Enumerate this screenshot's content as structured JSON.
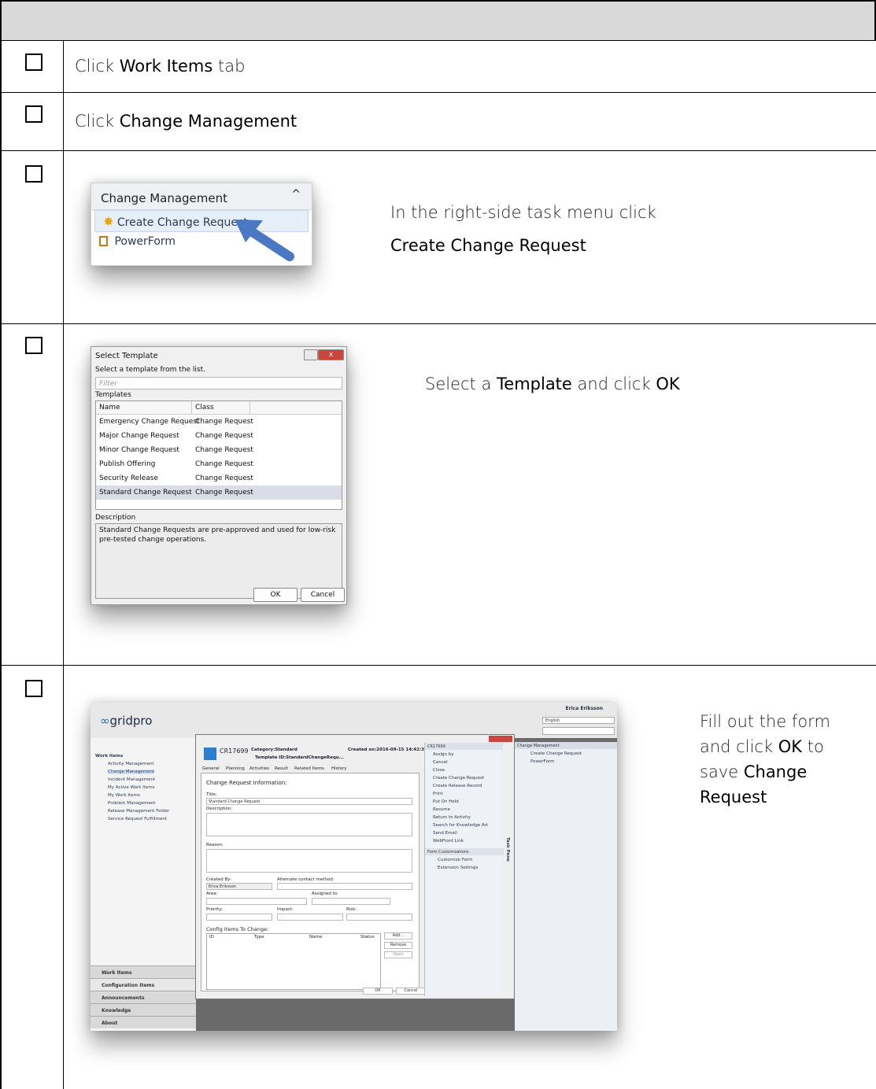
{
  "rows": [
    {
      "text_pre": "Click ",
      "bold": "Work Items",
      "text_post": " tab"
    },
    {
      "text_pre": "Click ",
      "bold": "Change Management",
      "text_post": ""
    }
  ],
  "step3": {
    "line1": "In the right-side task menu click",
    "bold": "Create Change Request",
    "shot": {
      "header": "Change Management",
      "items": [
        "Create Change Request",
        "PowerForm"
      ]
    }
  },
  "step4": {
    "pre": "Select a ",
    "bold1": "Template",
    "mid": " and click ",
    "bold2": "OK",
    "dialog": {
      "title": "Select Template",
      "instruction": "Select a template from the list.",
      "filter_placeholder": "Filter",
      "templates_label": "Templates",
      "columns": [
        "Name",
        "Class"
      ],
      "rows": [
        [
          "Emergency Change Request",
          "Change Request"
        ],
        [
          "Major Change Request",
          "Change Request"
        ],
        [
          "Minor Change Request",
          "Change Request"
        ],
        [
          "Publish Offering",
          "Change Request"
        ],
        [
          "Security Release",
          "Change Request"
        ],
        [
          "Standard Change Request",
          "Change Request"
        ]
      ],
      "description_label": "Description",
      "description": "Standard Change Requests are pre-approved and used for low-risk pre-tested change operations.",
      "ok": "OK",
      "cancel": "Cancel"
    }
  },
  "step5": {
    "l1": "Fill out the form",
    "l2pre": "and click ",
    "l2bold": "OK",
    "l2post": " to",
    "l3pre": "save ",
    "l3bold": "Change",
    "l4bold": "Request",
    "shot": {
      "logo": "gridpro",
      "user": "Erica Eriksson",
      "language": "English",
      "tree": [
        "Work Items",
        "Activity Management",
        "Change Management",
        "Incident Management",
        "My Active Work Items",
        "My Work Items",
        "Problem Management",
        "Release Management Folder",
        "Service Request Fulfillment"
      ],
      "nav": [
        "Work Items",
        "Configuration Items",
        "Announcements",
        "Knowledge",
        "About"
      ],
      "cr_id": "CR17699",
      "category": "Category:Standard",
      "template": "Template ID:StandardChangeRequ...",
      "created": "Created on:2016-09-15 14:42:33",
      "tabs": [
        "General",
        "Planning",
        "Activities",
        "Result",
        "Related Items",
        "History"
      ],
      "section": "Change Request Information:",
      "title_label": "Title:",
      "title_value": "Standard Change Request",
      "description_label": "Description:",
      "reason_label": "Reason:",
      "created_by_label": "Created By:",
      "created_by": "Erica Eriksson",
      "alt_contact": "Alternate contact method:",
      "area": "Area:",
      "assigned": "Assigned to:",
      "priority": "Priority:",
      "impact": "Impact:",
      "risk": "Risk:",
      "config": "Config Items To Change:",
      "cols": [
        "ID",
        "Type",
        "Name",
        "Status"
      ],
      "add": "Add...",
      "remove": "Remove",
      "open": "Open",
      "ok": "OK",
      "cancel": "Cancel",
      "tasks_title": "CR17699",
      "tasks": [
        "Assign by",
        "Cancel",
        "Close",
        "Create Change Request",
        "Create Release Record",
        "Print",
        "Put On Hold",
        "Resume",
        "Return to Activity",
        "Search for Knowledge Art",
        "Send Email",
        "WebFront Link"
      ],
      "form_cust": "Form Customizations",
      "cust": [
        "Customize Form",
        "Extension Settings"
      ],
      "task_pane": "Task Pane",
      "right_title": "Change Management",
      "right_items": [
        "Create Change Request",
        "PowerForm"
      ]
    }
  }
}
